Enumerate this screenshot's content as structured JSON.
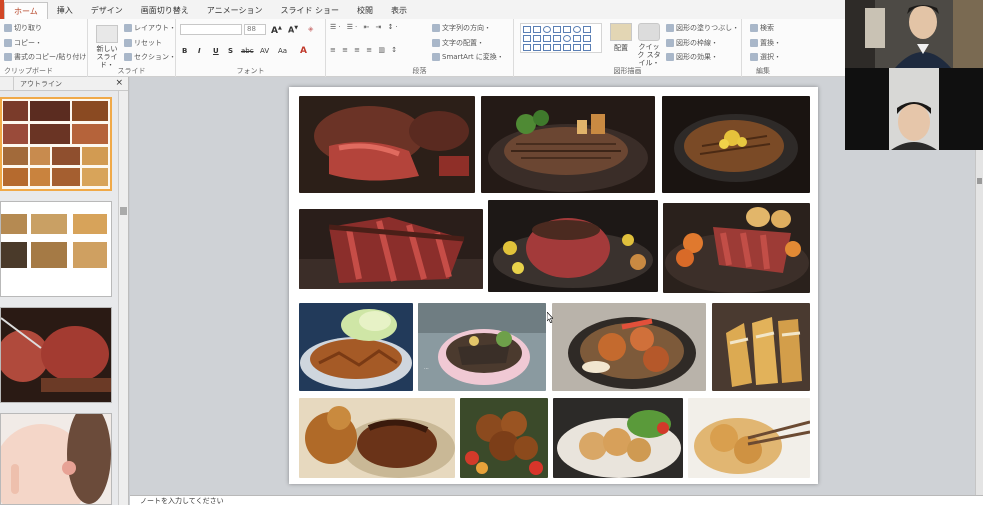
{
  "ribbon_tabs": [
    {
      "label": "ホーム",
      "active": true
    },
    {
      "label": "挿入"
    },
    {
      "label": "デザイン"
    },
    {
      "label": "画面切り替え"
    },
    {
      "label": "アニメーション"
    },
    {
      "label": "スライド ショー"
    },
    {
      "label": "校閲"
    },
    {
      "label": "表示"
    }
  ],
  "clipboard": {
    "cut": "切り取り",
    "copy": "コピー・",
    "format_painter": "書式のコピー/貼り付け",
    "label": "クリップボード"
  },
  "slides_group": {
    "new_slide": "新しい スライド・",
    "layout": "レイアウト・",
    "reset": "リセット",
    "section": "セクション・",
    "label": "スライド"
  },
  "font_group": {
    "size_value": "88",
    "bold": "B",
    "italic": "I",
    "underline": "U",
    "strike": "S",
    "abc": "abc",
    "spacing": "AV",
    "case": "Aa",
    "label": "フォント"
  },
  "paragraph_group": {
    "text_direction": "文字列の方向・",
    "align_text": "文字の配置・",
    "smartart": "SmartArt に変換・",
    "label": "段落"
  },
  "drawing_group": {
    "arrange": "配置",
    "quick_styles": "クイック スタイル・",
    "fill": "図形の塗りつぶし・",
    "outline": "図形の枠線・",
    "effects": "図形の効果・",
    "label": "図形描画"
  },
  "editing_group": {
    "find": "検索",
    "replace": "置換・",
    "select": "選択・",
    "label": "編集"
  },
  "left_pane": {
    "tab_outline": "アウトライン",
    "close": "×"
  },
  "notes": {
    "placeholder": "ノートを入力してください"
  },
  "colors": {
    "accent": "#b7472a",
    "ribbon_bg": "#fbfbfb",
    "edit_bg": "#cfd2d6",
    "selected_thumb": "#f0a948"
  }
}
